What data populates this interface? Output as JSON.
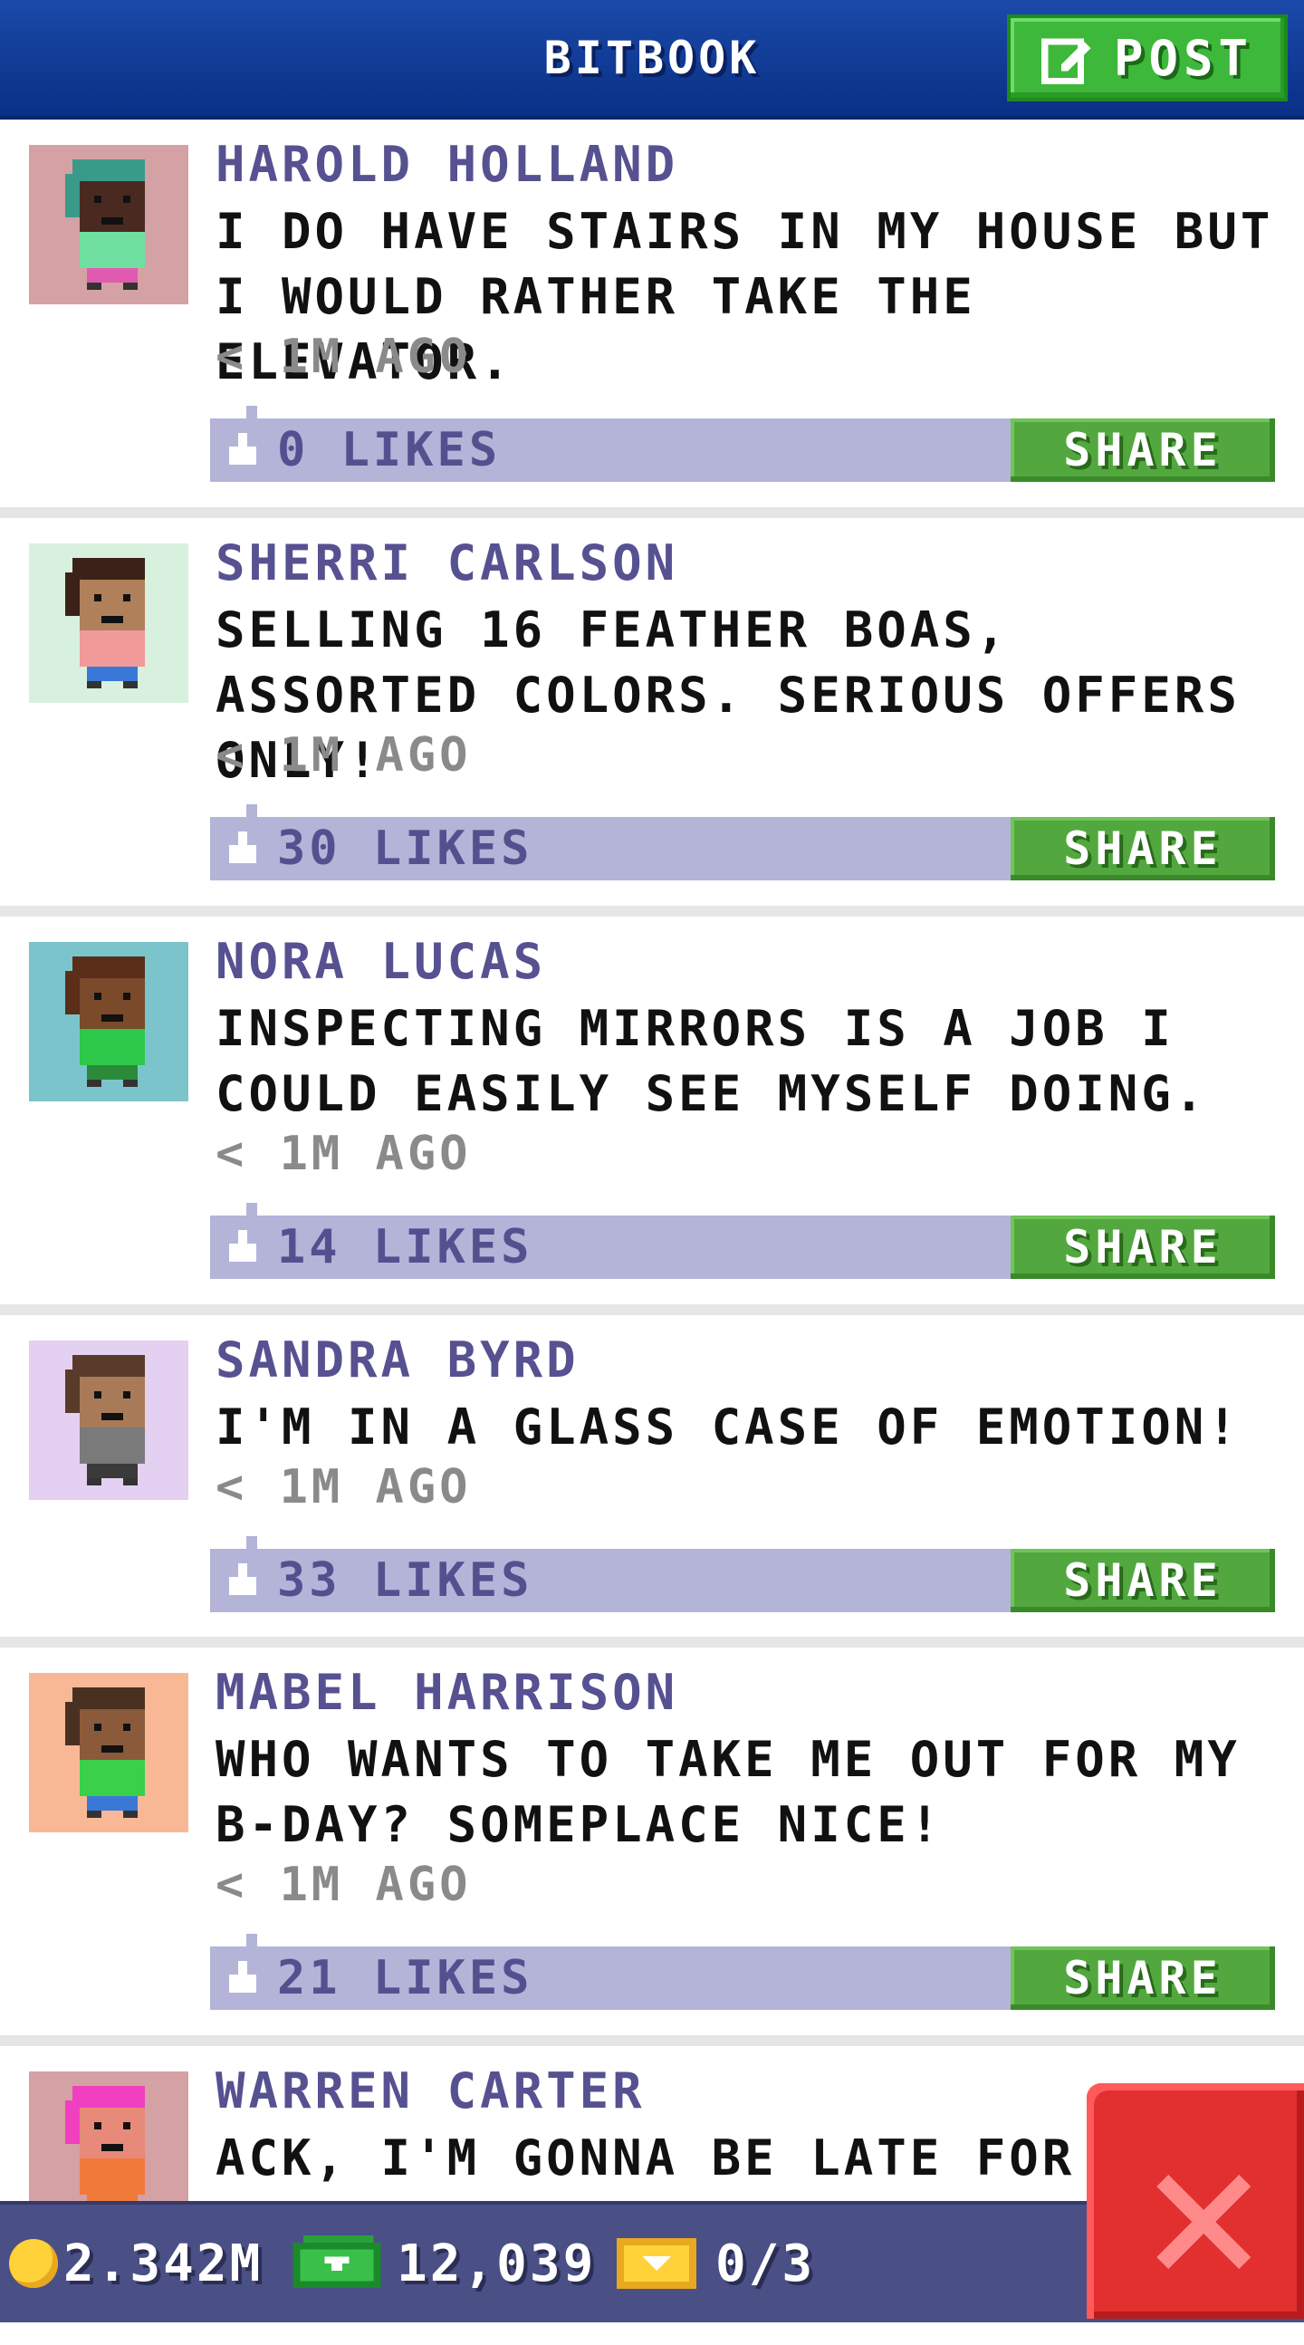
{
  "header": {
    "title": "BITBOOK",
    "post_label": "POST"
  },
  "posts": [
    {
      "name": "HAROLD HOLLAND",
      "text": "I DO HAVE STAIRS IN MY HOUSE BUT I WOULD RATHER TAKE THE ELEVATOR.",
      "time": "< 1M AGO",
      "likes": "0 LIKES",
      "share": "SHARE",
      "avatar_bg": "#d4a1a4",
      "avatar_hair": "#3a9a8a",
      "avatar_skin": "#4a2a20",
      "avatar_shirt": "#6fe0a0",
      "avatar_pants": "#e05ab0"
    },
    {
      "name": "SHERRI CARLSON",
      "text": "SELLING 16 FEATHER BOAS, ASSORTED COLORS. SERIOUS OFFERS ONLY!",
      "time": "< 1M AGO",
      "likes": "30 LIKES",
      "share": "SHARE",
      "avatar_bg": "#d8f0de",
      "avatar_hair": "#3a2218",
      "avatar_skin": "#b0805a",
      "avatar_shirt": "#f09a9a",
      "avatar_pants": "#3a78d8"
    },
    {
      "name": "NORA LUCAS",
      "text": "INSPECTING MIRRORS IS A JOB I COULD EASILY SEE MYSELF DOING.",
      "time": "< 1M AGO",
      "likes": "14 LIKES",
      "share": "SHARE",
      "avatar_bg": "#7cc4cc",
      "avatar_hair": "#5a2e18",
      "avatar_skin": "#7a4a2a",
      "avatar_shirt": "#2ec84a",
      "avatar_pants": "#2a8a3a"
    },
    {
      "name": "SANDRA BYRD",
      "text": "I'M IN A GLASS CASE OF EMOTION!",
      "time": "< 1M AGO",
      "likes": "33 LIKES",
      "share": "SHARE",
      "avatar_bg": "#e4d0f0",
      "avatar_hair": "#5a3a2a",
      "avatar_skin": "#a87a58",
      "avatar_shirt": "#7a7a7a",
      "avatar_pants": "#3a3a3a"
    },
    {
      "name": "MABEL HARRISON",
      "text": "WHO WANTS TO TAKE ME OUT FOR MY B-DAY? SOMEPLACE NICE!",
      "time": "< 1M AGO",
      "likes": "21 LIKES",
      "share": "SHARE",
      "avatar_bg": "#f8b896",
      "avatar_hair": "#4a3020",
      "avatar_skin": "#8a5a3a",
      "avatar_shirt": "#3ad04a",
      "avatar_pants": "#3a78d8"
    },
    {
      "name": "WARREN CARTER",
      "text": "ACK, I'M GONNA BE LATE FOR MY",
      "time": "",
      "likes": "",
      "share": "",
      "avatar_bg": "#d4a1a4",
      "avatar_hair": "#f040c0",
      "avatar_skin": "#e88a7a",
      "avatar_shirt": "#f07a3a",
      "avatar_pants": "#f07a3a"
    }
  ],
  "status_bar": {
    "coins": "2.342M",
    "bux": "12,039",
    "tickets": "0/3"
  },
  "icons": {
    "post": "edit-icon",
    "like": "thumbs-up-icon",
    "coin": "coin-icon",
    "bux": "bux-icon",
    "ticket": "ticket-icon",
    "close": "close-icon"
  },
  "colors": {
    "header": "#0f3a96",
    "name": "#565190",
    "likes_bar": "#b3b4d8",
    "share": "#52a83e",
    "post_button": "#3db83a",
    "bottom_bar": "#4a4f85",
    "close": "#e23030"
  }
}
